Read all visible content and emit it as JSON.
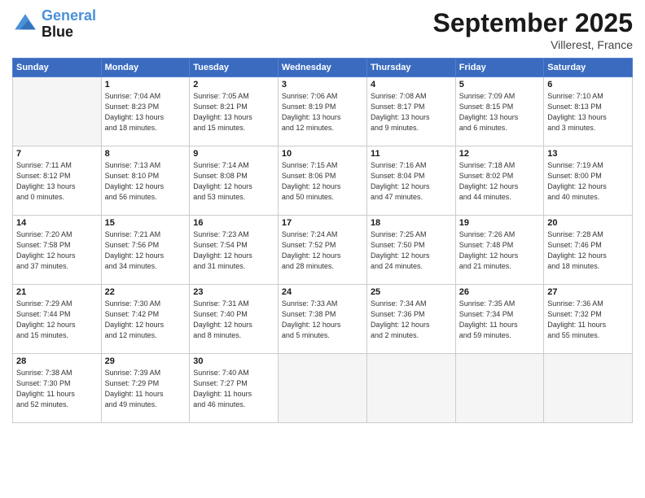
{
  "header": {
    "logo_line1": "General",
    "logo_line2": "Blue",
    "month_title": "September 2025",
    "location": "Villerest, France"
  },
  "days_of_week": [
    "Sunday",
    "Monday",
    "Tuesday",
    "Wednesday",
    "Thursday",
    "Friday",
    "Saturday"
  ],
  "weeks": [
    [
      {
        "day": "",
        "info": ""
      },
      {
        "day": "1",
        "info": "Sunrise: 7:04 AM\nSunset: 8:23 PM\nDaylight: 13 hours\nand 18 minutes."
      },
      {
        "day": "2",
        "info": "Sunrise: 7:05 AM\nSunset: 8:21 PM\nDaylight: 13 hours\nand 15 minutes."
      },
      {
        "day": "3",
        "info": "Sunrise: 7:06 AM\nSunset: 8:19 PM\nDaylight: 13 hours\nand 12 minutes."
      },
      {
        "day": "4",
        "info": "Sunrise: 7:08 AM\nSunset: 8:17 PM\nDaylight: 13 hours\nand 9 minutes."
      },
      {
        "day": "5",
        "info": "Sunrise: 7:09 AM\nSunset: 8:15 PM\nDaylight: 13 hours\nand 6 minutes."
      },
      {
        "day": "6",
        "info": "Sunrise: 7:10 AM\nSunset: 8:13 PM\nDaylight: 13 hours\nand 3 minutes."
      }
    ],
    [
      {
        "day": "7",
        "info": "Sunrise: 7:11 AM\nSunset: 8:12 PM\nDaylight: 13 hours\nand 0 minutes."
      },
      {
        "day": "8",
        "info": "Sunrise: 7:13 AM\nSunset: 8:10 PM\nDaylight: 12 hours\nand 56 minutes."
      },
      {
        "day": "9",
        "info": "Sunrise: 7:14 AM\nSunset: 8:08 PM\nDaylight: 12 hours\nand 53 minutes."
      },
      {
        "day": "10",
        "info": "Sunrise: 7:15 AM\nSunset: 8:06 PM\nDaylight: 12 hours\nand 50 minutes."
      },
      {
        "day": "11",
        "info": "Sunrise: 7:16 AM\nSunset: 8:04 PM\nDaylight: 12 hours\nand 47 minutes."
      },
      {
        "day": "12",
        "info": "Sunrise: 7:18 AM\nSunset: 8:02 PM\nDaylight: 12 hours\nand 44 minutes."
      },
      {
        "day": "13",
        "info": "Sunrise: 7:19 AM\nSunset: 8:00 PM\nDaylight: 12 hours\nand 40 minutes."
      }
    ],
    [
      {
        "day": "14",
        "info": "Sunrise: 7:20 AM\nSunset: 7:58 PM\nDaylight: 12 hours\nand 37 minutes."
      },
      {
        "day": "15",
        "info": "Sunrise: 7:21 AM\nSunset: 7:56 PM\nDaylight: 12 hours\nand 34 minutes."
      },
      {
        "day": "16",
        "info": "Sunrise: 7:23 AM\nSunset: 7:54 PM\nDaylight: 12 hours\nand 31 minutes."
      },
      {
        "day": "17",
        "info": "Sunrise: 7:24 AM\nSunset: 7:52 PM\nDaylight: 12 hours\nand 28 minutes."
      },
      {
        "day": "18",
        "info": "Sunrise: 7:25 AM\nSunset: 7:50 PM\nDaylight: 12 hours\nand 24 minutes."
      },
      {
        "day": "19",
        "info": "Sunrise: 7:26 AM\nSunset: 7:48 PM\nDaylight: 12 hours\nand 21 minutes."
      },
      {
        "day": "20",
        "info": "Sunrise: 7:28 AM\nSunset: 7:46 PM\nDaylight: 12 hours\nand 18 minutes."
      }
    ],
    [
      {
        "day": "21",
        "info": "Sunrise: 7:29 AM\nSunset: 7:44 PM\nDaylight: 12 hours\nand 15 minutes."
      },
      {
        "day": "22",
        "info": "Sunrise: 7:30 AM\nSunset: 7:42 PM\nDaylight: 12 hours\nand 12 minutes."
      },
      {
        "day": "23",
        "info": "Sunrise: 7:31 AM\nSunset: 7:40 PM\nDaylight: 12 hours\nand 8 minutes."
      },
      {
        "day": "24",
        "info": "Sunrise: 7:33 AM\nSunset: 7:38 PM\nDaylight: 12 hours\nand 5 minutes."
      },
      {
        "day": "25",
        "info": "Sunrise: 7:34 AM\nSunset: 7:36 PM\nDaylight: 12 hours\nand 2 minutes."
      },
      {
        "day": "26",
        "info": "Sunrise: 7:35 AM\nSunset: 7:34 PM\nDaylight: 11 hours\nand 59 minutes."
      },
      {
        "day": "27",
        "info": "Sunrise: 7:36 AM\nSunset: 7:32 PM\nDaylight: 11 hours\nand 55 minutes."
      }
    ],
    [
      {
        "day": "28",
        "info": "Sunrise: 7:38 AM\nSunset: 7:30 PM\nDaylight: 11 hours\nand 52 minutes."
      },
      {
        "day": "29",
        "info": "Sunrise: 7:39 AM\nSunset: 7:29 PM\nDaylight: 11 hours\nand 49 minutes."
      },
      {
        "day": "30",
        "info": "Sunrise: 7:40 AM\nSunset: 7:27 PM\nDaylight: 11 hours\nand 46 minutes."
      },
      {
        "day": "",
        "info": ""
      },
      {
        "day": "",
        "info": ""
      },
      {
        "day": "",
        "info": ""
      },
      {
        "day": "",
        "info": ""
      }
    ]
  ]
}
